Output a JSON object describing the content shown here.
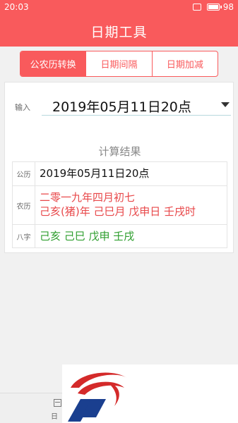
{
  "status_bar": {
    "time": "20:03",
    "battery": "98"
  },
  "header": {
    "title": "日期工具"
  },
  "tabs": [
    {
      "label": "公农历转换",
      "active": true
    },
    {
      "label": "日期间隔",
      "active": false
    },
    {
      "label": "日期加减",
      "active": false
    }
  ],
  "input": {
    "label": "输入",
    "value": "2019年05月11日20点"
  },
  "result": {
    "title": "计算结果",
    "rows": [
      {
        "label": "公历",
        "line1": "2019年05月11日20点"
      },
      {
        "label": "农历",
        "line1": "二零一九年四月初七",
        "line2": "己亥(猪)年 己巳月 戊申日 壬戌时"
      },
      {
        "label": "八字",
        "line1": "己亥 己巳 戊申 壬戌"
      }
    ]
  },
  "bottom_nav": {
    "label": "日"
  },
  "colors": {
    "accent": "#f95a5c",
    "lunar_text": "#e8484a",
    "bazi_text": "#2e9e2e"
  },
  "icons": {
    "dropdown": "triangle-down-icon",
    "battery": "battery-icon",
    "calendar": "calendar-icon"
  }
}
